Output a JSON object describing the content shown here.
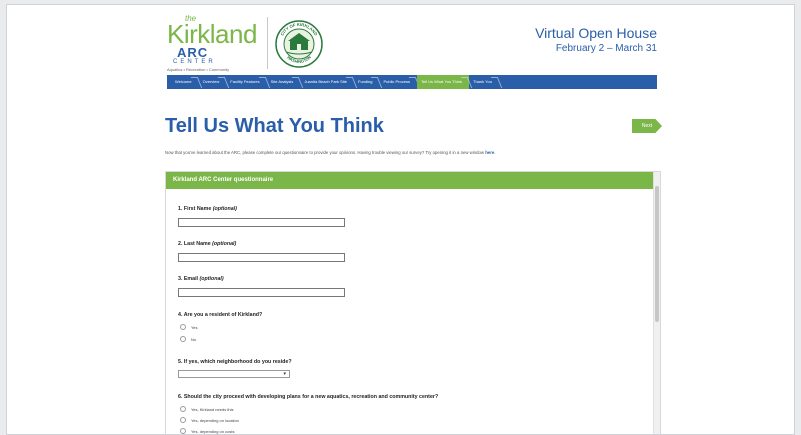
{
  "branding": {
    "logo_small": "the",
    "logo_name": "Kirkland",
    "logo_arc": "ARC",
    "logo_center": "CENTER",
    "logo_tagline": "Aquatics • Recreation • Community",
    "seal_top_text": "CITY OF KIRKLAND",
    "seal_bottom_text": "WASHINGTON"
  },
  "header": {
    "title": "Virtual Open House",
    "dates": "February 2 – March 31"
  },
  "nav": {
    "items": [
      {
        "label": "Welcome"
      },
      {
        "label": "Overview"
      },
      {
        "label": "Facility Features"
      },
      {
        "label": "Site Analysis"
      },
      {
        "label": "Juanita Beach Park Site"
      },
      {
        "label": "Funding"
      },
      {
        "label": "Public Process"
      },
      {
        "label": "Tell Us What You Think"
      },
      {
        "label": "Thank You"
      }
    ],
    "active_index": 7
  },
  "main": {
    "heading": "Tell Us What You Think",
    "next_label": "Next",
    "intro_text": "Now that you've learned about the ARC, please complete our questionnaire to provide your opinions. Having trouble viewing our survey? Try opening it in a new window",
    "intro_link": "here",
    "intro_end": "."
  },
  "questionnaire": {
    "header": "Kirkland ARC Center questionnaire",
    "q1": {
      "label": "1. First Name",
      "optional": "(optional)"
    },
    "q2": {
      "label": "2. Last Name",
      "optional": "(optional)"
    },
    "q3": {
      "label": "3. Email",
      "optional": "(optional)"
    },
    "q4": {
      "label": "4. Are you a resident of Kirkland?",
      "options": [
        "Yes",
        "No"
      ]
    },
    "q5": {
      "label": "5. If yes, which neighborhood do you reside?",
      "selected": ""
    },
    "q6": {
      "label": "6. Should the city proceed with developing plans for a new aquatics, recreation and community center?",
      "options": [
        "Yes, Kirkland needs this",
        "Yes, depending on location",
        "Yes, depending on costs"
      ]
    }
  },
  "colors": {
    "brand_blue": "#2a5ea8",
    "brand_green": "#7ab648"
  }
}
